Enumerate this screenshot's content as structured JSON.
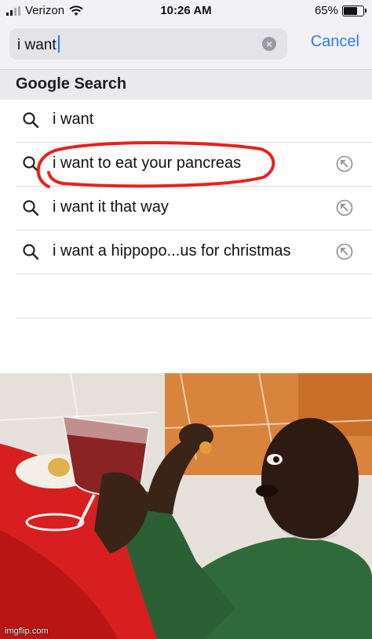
{
  "status_bar": {
    "carrier": "Verizon",
    "time": "10:26 AM",
    "battery": "65%",
    "battery_level": 0.65
  },
  "search": {
    "query": "i want",
    "cancel_label": "Cancel"
  },
  "suggestions": {
    "header": "Google Search",
    "items": [
      {
        "label": "i want",
        "icon": "search-icon"
      },
      {
        "label": "i want to eat your pancreas",
        "icon": "search-icon",
        "action_icon": "fill-arrow-icon"
      },
      {
        "label": "i want it that way",
        "icon": "search-icon",
        "action_icon": "fill-arrow-icon"
      },
      {
        "label": "i want a hippopo...us for christmas",
        "icon": "search-icon",
        "action_icon": "fill-arrow-icon"
      }
    ]
  },
  "photo": {
    "watermark": "imgflip.com"
  },
  "colors": {
    "accent": "#2a7bf5",
    "highlight_ring": "#e8211d"
  }
}
